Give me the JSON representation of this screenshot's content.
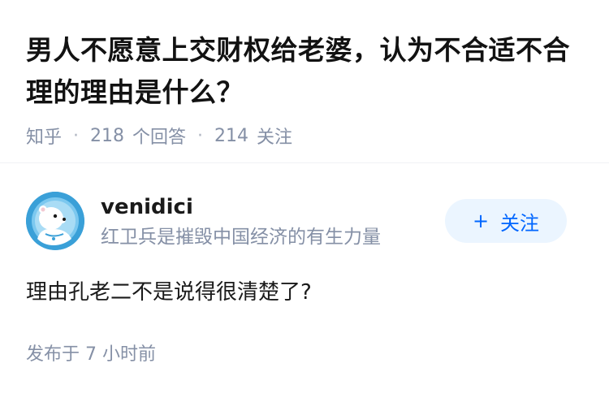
{
  "question": {
    "title": "男人不愿意上交财权给老婆，认为不合适不合理的理由是什么？",
    "source": "知乎",
    "answer_count": "218",
    "answer_label": "个回答",
    "follower_count": "214",
    "follower_label": "关注"
  },
  "answer": {
    "author": {
      "name": "venidici",
      "bio": "红卫兵是摧毁中国经济的有生力量",
      "avatar_icon": "polar-bear-astronaut-icon"
    },
    "follow_button": {
      "icon": "+",
      "label": "关注"
    },
    "content": "理由孔老二不是说得很清楚了?",
    "publish_time": "发布于 7 小时前"
  },
  "colors": {
    "accent": "#0066ff",
    "follow_bg": "#ebf5ff",
    "meta_text": "#8590a6",
    "avatar_bg": "#3aa0d8"
  }
}
